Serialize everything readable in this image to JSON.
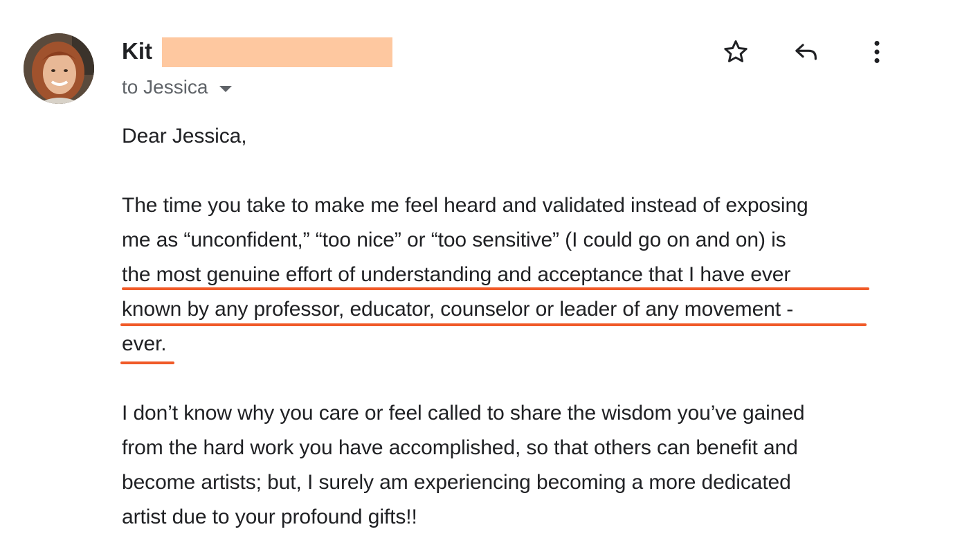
{
  "message": {
    "sender": {
      "name": "Kit",
      "avatar_icon": "profile-photo"
    },
    "recipient_label": "to Jessica",
    "actions": {
      "star_icon": "star-outline-icon",
      "reply_icon": "reply-icon",
      "more_icon": "more-vertical-icon"
    },
    "body": {
      "greeting": "Dear Jessica,",
      "paragraph1": {
        "line1": "The time you take to make me feel heard and validated instead of exposing",
        "line2": "me as “unconfident,” “too nice” or “too sensitive” (I could go on and on) is",
        "line3": "the most genuine effort of understanding and acceptance that I have ever",
        "line4": "known by any professor, educator, counselor or leader of any movement -",
        "line5": "ever."
      },
      "paragraph2": {
        "line1": "I don’t know why you care or feel called to share the wisdom you’ve gained",
        "line2": "from the hard work you have accomplished, so that others can benefit and",
        "line3": "become artists; but, I surely am experiencing becoming a more dedicated",
        "line4": "artist due to your profound gifts!!"
      }
    },
    "highlight_color": "#f05a28",
    "redaction_color": "#fec8a0"
  }
}
